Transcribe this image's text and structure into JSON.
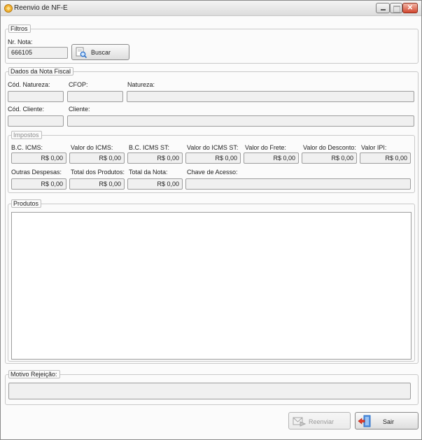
{
  "window": {
    "title": "Reenvio de NF-E"
  },
  "filtros": {
    "legend": "Filtros",
    "nr_nota_label": "Nr. Nota:",
    "nr_nota_value": "666105",
    "buscar_label": "Buscar"
  },
  "dados": {
    "legend": "Dados da Nota Fiscal",
    "cod_natureza_label": "Cód. Natureza:",
    "cfop_label": "CFOP:",
    "natureza_label": "Natureza:",
    "cod_cliente_label": "Cód. Cliente:",
    "cliente_label": "Cliente:",
    "cod_natureza_value": "",
    "cfop_value": "",
    "natureza_value": "",
    "cod_cliente_value": "",
    "cliente_value": ""
  },
  "impostos": {
    "legend": "Impostos",
    "bc_icms_label": "B.C. ICMS:",
    "valor_icms_label": "Valor do ICMS:",
    "bc_icms_st_label": "B.C. ICMS ST:",
    "valor_icms_st_label": "Valor do ICMS ST:",
    "valor_frete_label": "Valor do Frete:",
    "valor_desconto_label": "Valor do Desconto:",
    "valor_ipi_label": "Valor IPI:",
    "outras_despesas_label": "Outras Despesas:",
    "total_produtos_label": "Total dos Produtos:",
    "total_nota_label": "Total da Nota:",
    "chave_acesso_label": "Chave de Acesso:",
    "bc_icms_value": "R$ 0,00",
    "valor_icms_value": "R$ 0,00",
    "bc_icms_st_value": "R$ 0,00",
    "valor_icms_st_value": "R$ 0,00",
    "valor_frete_value": "R$ 0,00",
    "valor_desconto_value": "R$ 0,00",
    "valor_ipi_value": "R$ 0,00",
    "outras_despesas_value": "R$ 0,00",
    "total_produtos_value": "R$ 0,00",
    "total_nota_value": "R$ 0,00",
    "chave_acesso_value": ""
  },
  "produtos": {
    "legend": "Produtos"
  },
  "motivo": {
    "legend": "Motivo Rejeição:",
    "value": ""
  },
  "actions": {
    "reenviar_label": "Reenviar",
    "sair_label": "Sair"
  },
  "colors": {
    "accent_orange": "#e8a21a",
    "close_red": "#d2472f",
    "exit_blue": "#2a6fc9"
  },
  "icons": {
    "title": "app-icon",
    "buscar": "search-document-icon",
    "reenviar": "send-envelope-icon",
    "sair": "exit-door-icon"
  }
}
